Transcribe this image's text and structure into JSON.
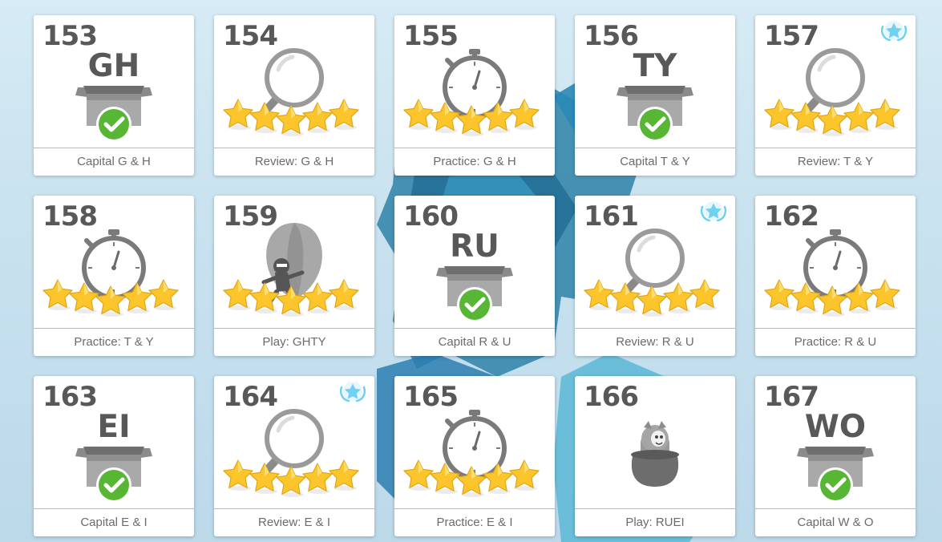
{
  "lessons": [
    {
      "number": "153",
      "letters": "GH",
      "type": "capital",
      "label": "Capital G & H",
      "badge": false
    },
    {
      "number": "154",
      "letters": "",
      "type": "review",
      "label": "Review: G & H",
      "badge": false
    },
    {
      "number": "155",
      "letters": "",
      "type": "practice",
      "label": "Practice: G & H",
      "badge": false
    },
    {
      "number": "156",
      "letters": "TY",
      "type": "capital",
      "label": "Capital T & Y",
      "badge": false
    },
    {
      "number": "157",
      "letters": "",
      "type": "review",
      "label": "Review: T & Y",
      "badge": true
    },
    {
      "number": "158",
      "letters": "",
      "type": "practice",
      "label": "Practice: T & Y",
      "badge": false
    },
    {
      "number": "159",
      "letters": "",
      "type": "play-balloon",
      "label": "Play: GHTY",
      "badge": false
    },
    {
      "number": "160",
      "letters": "RU",
      "type": "capital",
      "label": "Capital R & U",
      "badge": false
    },
    {
      "number": "161",
      "letters": "",
      "type": "review",
      "label": "Review: R & U",
      "badge": true
    },
    {
      "number": "162",
      "letters": "",
      "type": "practice",
      "label": "Practice: R & U",
      "badge": false
    },
    {
      "number": "163",
      "letters": "EI",
      "type": "capital",
      "label": "Capital E & I",
      "badge": false
    },
    {
      "number": "164",
      "letters": "",
      "type": "review",
      "label": "Review: E & I",
      "badge": true
    },
    {
      "number": "165",
      "letters": "",
      "type": "practice",
      "label": "Practice: E & I",
      "badge": false
    },
    {
      "number": "166",
      "letters": "",
      "type": "play-pot",
      "label": "Play: RUEI",
      "badge": false
    },
    {
      "number": "167",
      "letters": "WO",
      "type": "capital",
      "label": "Capital W & O",
      "badge": false
    }
  ],
  "colors": {
    "text": "#585858",
    "check": "#57b634",
    "star": "#fbc52b",
    "badge": "#6fd0f0"
  }
}
